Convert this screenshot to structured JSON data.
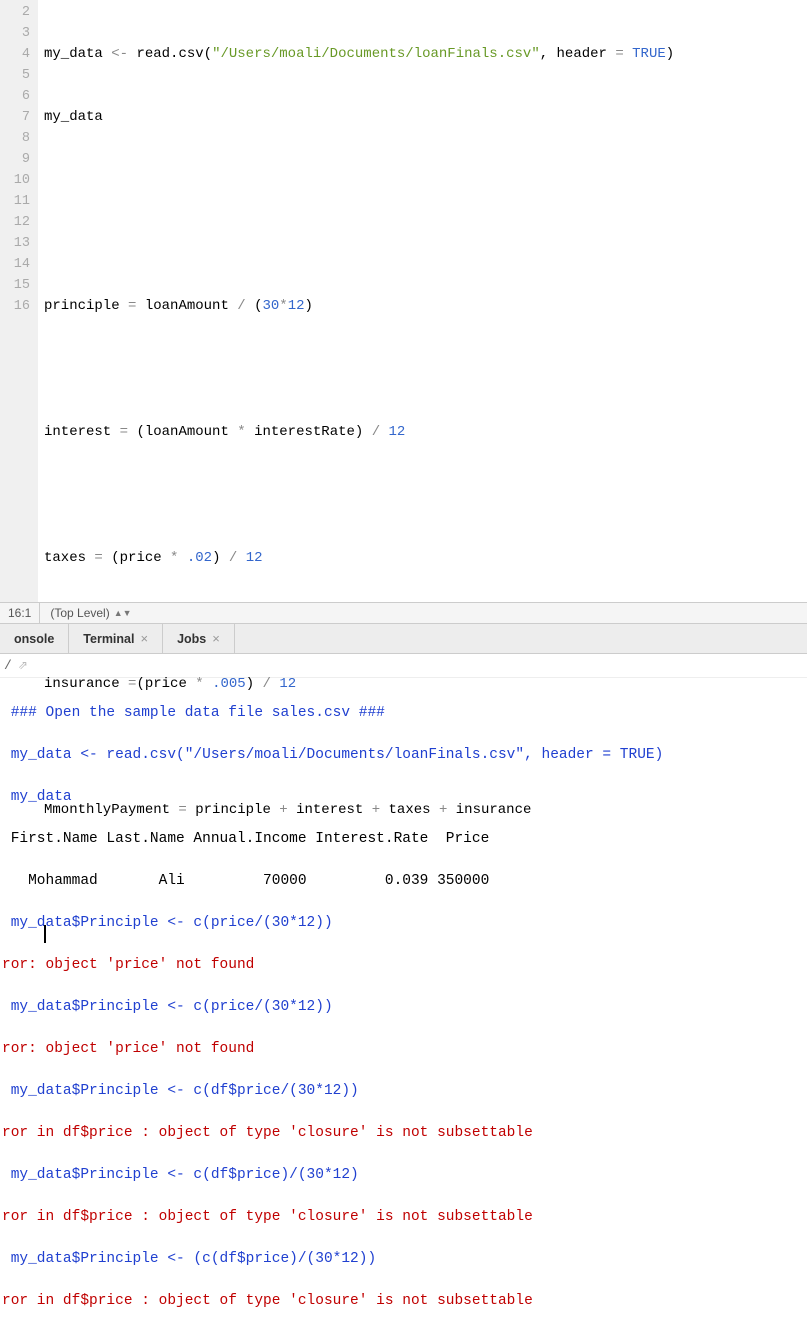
{
  "editor": {
    "gutter_start": 2,
    "gutter_end": 16,
    "lines": {
      "l2": {
        "var": "my_data",
        "assign": "<-",
        "fn": "read.csv",
        "str": "\"/Users/moali/Documents/loanFinals.csv\"",
        "arg": ", header",
        "eq": " = ",
        "val": "TRUE"
      },
      "l3": "my_data",
      "l6": {
        "lhs": "principle",
        "eq": " = ",
        "a": "loanAmount",
        "div": " / ",
        "paren_num": "(30*12)"
      },
      "l8": {
        "lhs": "interest",
        "eq": " = ",
        "open": "(",
        "a": "loanAmount",
        "mul": " * ",
        "b": "interestRate",
        "close": ")",
        "div": " / ",
        "num": "12"
      },
      "l10": {
        "lhs": "taxes",
        "eq": " = ",
        "open": "(",
        "a": "price",
        "mul": " * ",
        "num1": ".02",
        "close": ")",
        "div": " / ",
        "num2": "12"
      },
      "l12": {
        "lhs": "insurance",
        "eq": " =",
        "open": "(",
        "a": "price",
        "mul": " * ",
        "num1": ".005",
        "close": ")",
        "div": " / ",
        "num2": "12"
      },
      "l14": {
        "lhs": "MmonthlyPayment",
        "eq": " = ",
        "a": "principle",
        "p1": " + ",
        "b": "interest",
        "p2": " + ",
        "c": "taxes",
        "p3": " + ",
        "d": "insurance"
      }
    }
  },
  "status": {
    "pos": "16:1",
    "scope": "(Top Level)"
  },
  "tabs": {
    "console": "onsole",
    "terminal": "Terminal",
    "jobs": "Jobs"
  },
  "console_header": "/",
  "console": {
    "l1": " ### Open the sample data file sales.csv ###",
    "l2": " my_data <- read.csv(\"/Users/moali/Documents/loanFinals.csv\", header = TRUE)",
    "l3": " my_data",
    "l4": " First.Name Last.Name Annual.Income Interest.Rate  Price",
    "l5": "   Mohammad       Ali         70000         0.039 350000",
    "l6": " my_data$Principle <- c(price/(30*12))",
    "l7": "ror: object 'price' not found",
    "l8": " my_data$Principle <- c(price/(30*12))",
    "l9": "ror: object 'price' not found",
    "l10": " my_data$Principle <- c(df$price/(30*12))",
    "l11": "ror in df$price : object of type 'closure' is not subsettable",
    "l12": " my_data$Principle <- c(df$price)/(30*12)",
    "l13": "ror in df$price : object of type 'closure' is not subsettable",
    "l14": " my_data$Principle <- (c(df$price)/(30*12))",
    "l15": "ror in df$price : object of type 'closure' is not subsettable"
  }
}
